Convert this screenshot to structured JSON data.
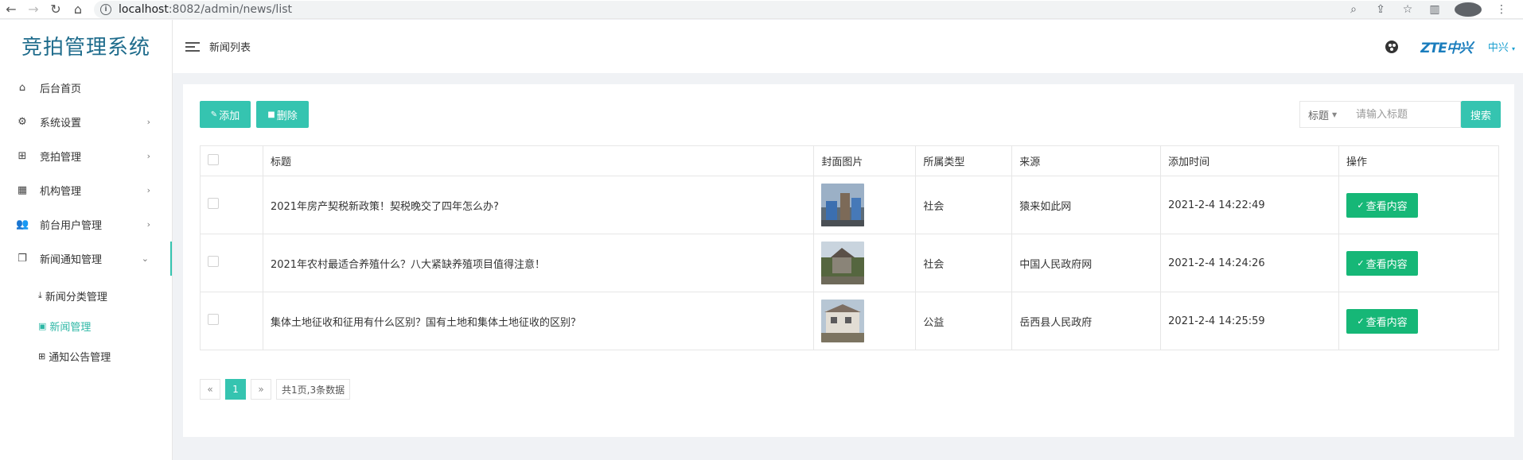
{
  "browser": {
    "host": "localhost",
    "path": ":8082/admin/news/list"
  },
  "app": {
    "title": "竞拍管理系统"
  },
  "sidebar": {
    "items": [
      {
        "label": "后台首页",
        "icon": "home-icon"
      },
      {
        "label": "系统设置",
        "icon": "gear-icon"
      },
      {
        "label": "竞拍管理",
        "icon": "grid-tree-icon"
      },
      {
        "label": "机构管理",
        "icon": "dashboard-icon"
      },
      {
        "label": "前台用户管理",
        "icon": "users-icon"
      },
      {
        "label": "新闻通知管理",
        "icon": "copy-icon"
      }
    ],
    "submenu": [
      {
        "label": "新闻分类管理",
        "icon": "download-icon"
      },
      {
        "label": "新闻管理",
        "icon": "news-icon",
        "active": true
      },
      {
        "label": "通知公告管理",
        "icon": "windows-icon"
      }
    ]
  },
  "header": {
    "title": "新闻列表",
    "brand": "ZTE中兴",
    "user": "中兴"
  },
  "toolbar": {
    "add_label": "添加",
    "delete_label": "删除",
    "search_field": "标题",
    "search_placeholder": "请输入标题",
    "search_label": "搜索"
  },
  "table": {
    "headers": [
      "标题",
      "封面图片",
      "所属类型",
      "来源",
      "添加时间",
      "操作"
    ],
    "rows": [
      {
        "title": "2021年房产契税新政策！契税晚交了四年怎么办?",
        "type": "社会",
        "source": "猿来如此网",
        "time": "2021-2-4 14:22:49",
        "action": "查看内容"
      },
      {
        "title": "2021年农村最适合养殖什么？八大紧缺养殖项目值得注意！",
        "type": "社会",
        "source": "中国人民政府网",
        "time": "2021-2-4 14:24:26",
        "action": "查看内容"
      },
      {
        "title": "集体土地征收和征用有什么区别？国有土地和集体土地征收的区别？",
        "type": "公益",
        "source": "岳西县人民政府",
        "time": "2021-2-4 14:25:59",
        "action": "查看内容"
      }
    ]
  },
  "pagination": {
    "prev": "«",
    "current": "1",
    "next": "»",
    "summary": "共1页,3条数据"
  },
  "colors": {
    "accent": "#35c4b0",
    "view_button": "#16b777",
    "time_text": "#23b07a",
    "logo_text": "#1f6c8c"
  }
}
